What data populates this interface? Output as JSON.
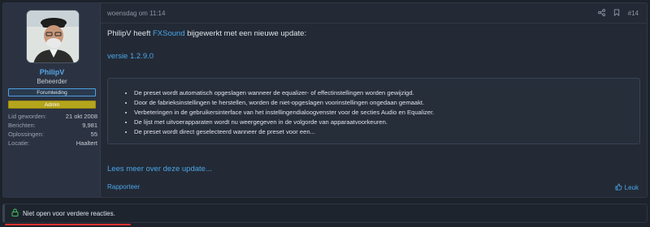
{
  "user": {
    "name": "PhilipV",
    "role": "Beheerder",
    "badges": [
      "Forumleiding",
      "Admin"
    ],
    "stats": [
      {
        "label": "Lid geworden:",
        "value": "21 okt 2008"
      },
      {
        "label": "Berichten:",
        "value": "9,981"
      },
      {
        "label": "Oplossingen:",
        "value": "55"
      },
      {
        "label": "Locatie:",
        "value": "Haaltert"
      }
    ]
  },
  "post": {
    "date": "woensdag om 11:14",
    "number": "#14",
    "author": "PhilipV",
    "message_part1": "heeft",
    "resource": "FXSound",
    "message_part2": "bijgewerkt met een nieuwe update:",
    "version": "versie 1.2.9.0",
    "bullets": [
      "De preset wordt automatisch opgeslagen wanneer de equalizer- of effectinstellingen worden gewijzigd.",
      "Door de fabrieksinstellingen te herstellen, worden de niet-opgeslagen voorinstellingen ongedaan gemaakt.",
      "Verbeteringen in de gebruikersinterface van het instellingendialoogvenster voor de secties Audio en Equalizer.",
      "De lijst met uitvoerapparaten wordt nu weergegeven in de volgorde van apparaatvoorkeuren.",
      "De preset wordt direct geselecteerd wanneer de preset voor een..."
    ],
    "read_more": "Lees meer over deze update...",
    "report": "Rapporteer",
    "like": "Leuk"
  },
  "thread_status": "Niet open voor verdere reacties.",
  "icons": [
    "share-icon",
    "bookmark-icon",
    "thumbs-up-icon",
    "lock-icon"
  ],
  "colors": {
    "link": "#4ba6ea",
    "admin_badge": "#b5a51d",
    "annotation": "#e0322f"
  }
}
